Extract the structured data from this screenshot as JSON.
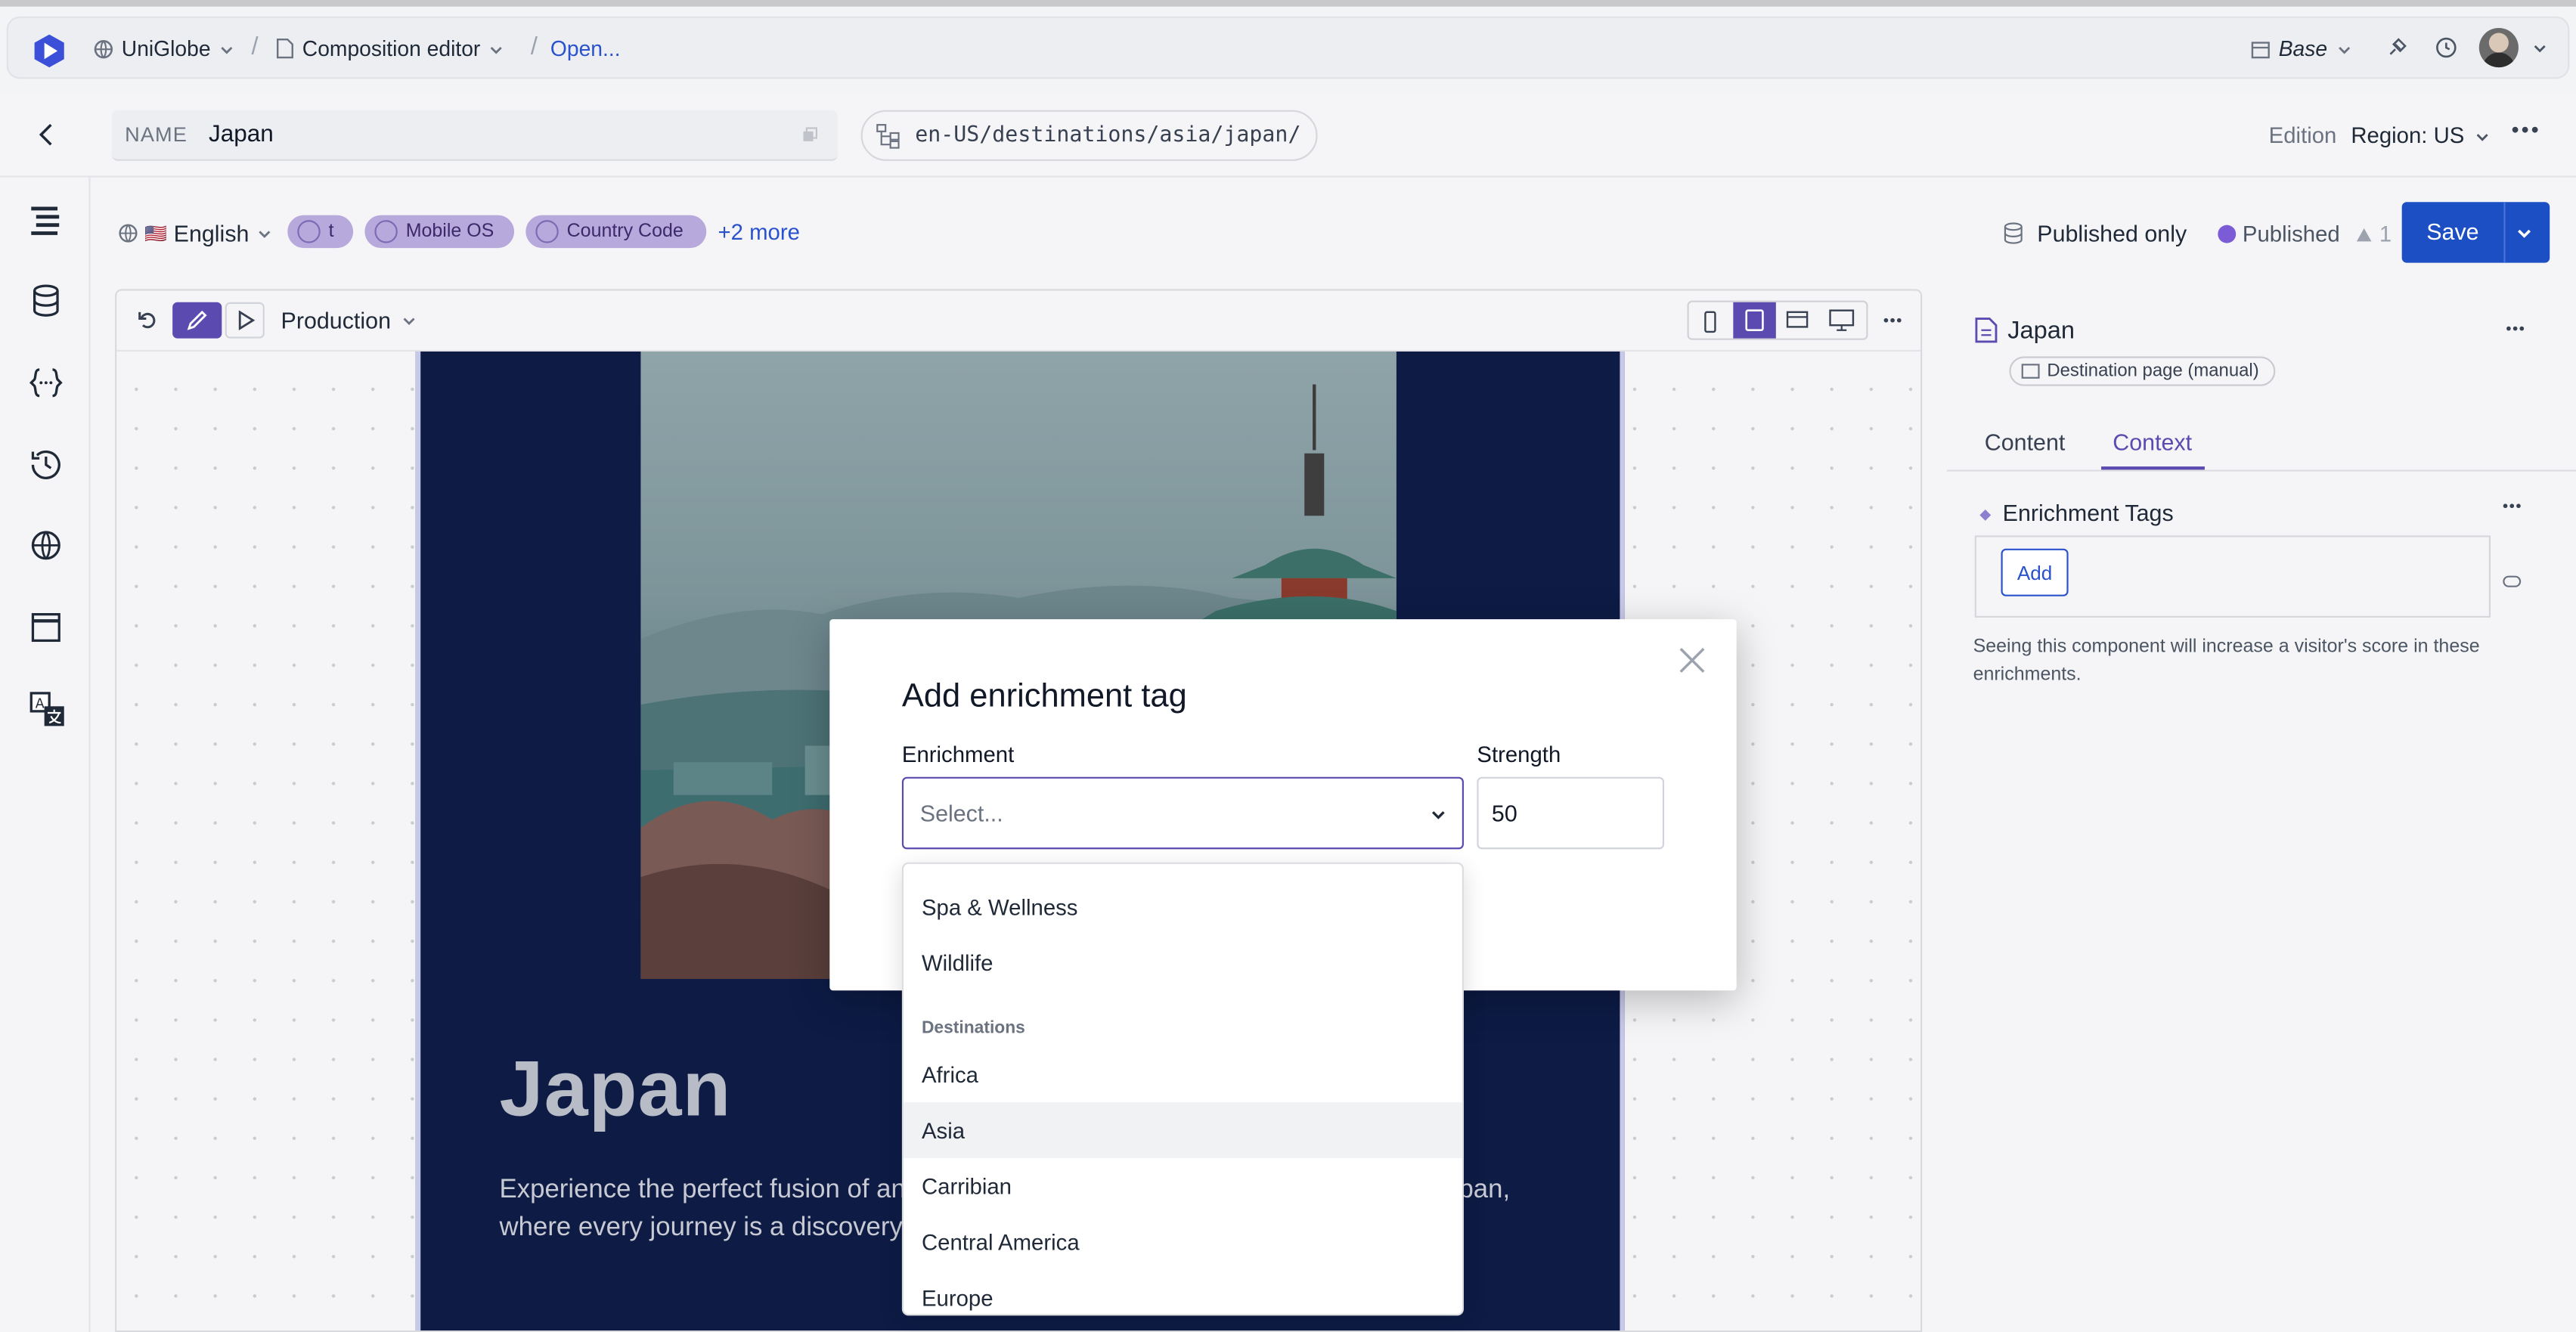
{
  "topbar": {
    "project": "UniGlobe",
    "editor": "Composition editor",
    "open_link": "Open...",
    "base_label": "Base"
  },
  "namebar": {
    "name_label": "NAME",
    "name_value": "Japan",
    "path": "en-US/destinations/asia/japan/",
    "edition_label": "Edition",
    "region_label": "Region: US"
  },
  "filters": {
    "language": "English",
    "flag": "🇺🇸",
    "chip_t": "t",
    "chip_mobile": "Mobile OS",
    "chip_country": "Country Code",
    "more": "+2 more"
  },
  "status": {
    "published_only": "Published only",
    "published": "Published",
    "warning_count": "1",
    "save": "Save"
  },
  "canvas": {
    "mode": "Production",
    "hero_title": "Japan",
    "hero_text_line1_left": "Experience the perfect fusion of an",
    "hero_text_line1_right": "pan,",
    "hero_text_line2": "where every journey is a discovery"
  },
  "rpanel": {
    "title": "Japan",
    "type_badge": "Destination page (manual)",
    "tab_content": "Content",
    "tab_context": "Context",
    "section_title": "Enrichment Tags",
    "add_label": "Add",
    "help_text_line1": "Seeing this component will increase a visitor's score in these",
    "help_text_line2": "enrichments."
  },
  "modal": {
    "title": "Add enrichment tag",
    "enrichment_label": "Enrichment",
    "select_placeholder": "Select...",
    "strength_label": "Strength",
    "strength_value": "50"
  },
  "dropdown": {
    "items_top": [
      "Spa & Wellness",
      "Wildlife"
    ],
    "group_label": "Destinations",
    "items_dest": [
      "Africa",
      "Asia",
      "Carribian",
      "Central America",
      "Europe"
    ],
    "highlighted": "Asia"
  },
  "colors": {
    "accent": "#5b4bb0",
    "save_blue": "#1d4fc4",
    "link_blue": "#2952cc",
    "preview_navy": "#0d1b45",
    "published_dot": "#7c5cd6"
  }
}
